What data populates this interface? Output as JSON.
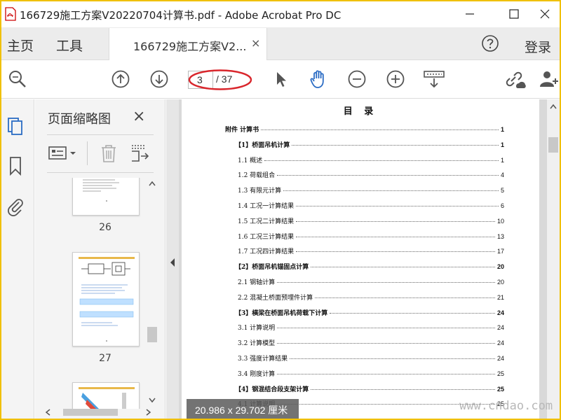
{
  "window": {
    "title": "166729施工方案V20220704计算书.pdf - Adobe Acrobat Pro DC",
    "controls": [
      "minimize-icon",
      "maximize-icon",
      "close-icon"
    ]
  },
  "nav": {
    "home": "主页",
    "tools": "工具",
    "doc_tab": "166729施工方案V2...",
    "doc_tab_close": "×",
    "help_icon": "help-icon",
    "login": "登录"
  },
  "toolbar": {
    "icons": [
      "zoom-search-icon",
      "page-up-icon",
      "page-down-icon",
      "select-arrow-icon",
      "hand-tool-icon",
      "zoom-out-icon",
      "zoom-in-icon",
      "fit-page-icon",
      "share-link-icon",
      "add-user-icon"
    ],
    "current_page": "3",
    "total_pages": "/ 37",
    "annotation_color": "#d9262c",
    "accent": "#2b6cc4"
  },
  "rail": {
    "icons": [
      "page-thumbnails-icon",
      "bookmark-icon",
      "attachment-icon"
    ]
  },
  "thumbnails": {
    "title": "页面缩略图",
    "close": "×",
    "tools": [
      "thumbnail-options-icon",
      "delete-page-icon",
      "extract-page-icon"
    ],
    "pages": [
      {
        "label": "26"
      },
      {
        "label": "27"
      }
    ]
  },
  "document": {
    "toc_title": "目 录",
    "toc": [
      {
        "text": "附件 计算书",
        "page": "1",
        "level": 0
      },
      {
        "text": "【1】桥面吊机计算",
        "page": "1",
        "level": 1
      },
      {
        "text": "1.1 概述",
        "page": "1",
        "level": 2
      },
      {
        "text": "1.2 荷载组合",
        "page": "4",
        "level": 2
      },
      {
        "text": "1.3 有限元计算",
        "page": "5",
        "level": 2
      },
      {
        "text": "1.4 工况一计算结果",
        "page": "6",
        "level": 2
      },
      {
        "text": "1.5 工况二计算结果",
        "page": "10",
        "level": 2
      },
      {
        "text": "1.6 工况三计算结果",
        "page": "13",
        "level": 2
      },
      {
        "text": "1.7 工况四计算结果",
        "page": "17",
        "level": 2
      },
      {
        "text": "【2】桥面吊机锚固点计算",
        "page": "20",
        "level": 1
      },
      {
        "text": "2.1 钢轴计算",
        "page": "20",
        "level": 2
      },
      {
        "text": "2.2 混凝土桥面预埋件计算",
        "page": "21",
        "level": 2
      },
      {
        "text": "【3】横梁在桥面吊机荷载下计算",
        "page": "24",
        "level": 1
      },
      {
        "text": "3.1 计算说明",
        "page": "24",
        "level": 2
      },
      {
        "text": "3.2 计算模型",
        "page": "24",
        "level": 2
      },
      {
        "text": "3.3 强度计算结果",
        "page": "24",
        "level": 2
      },
      {
        "text": "3.4 刚度计算",
        "page": "25",
        "level": 2
      },
      {
        "text": "【4】钢混结合段支架计算",
        "page": "25",
        "level": 1
      },
      {
        "text": "4.1 计算说明",
        "page": "25",
        "level": 2
      }
    ],
    "page_size": "20.986 x 29.702 厘米",
    "watermark": "www.cndao.com"
  }
}
